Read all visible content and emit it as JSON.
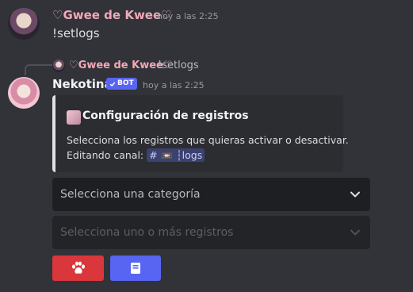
{
  "message1": {
    "author": "♡Gwee de Kwee♡",
    "timestamp": "hoy a las 2:25",
    "content": "!setlogs"
  },
  "reply": {
    "author": "♡Gwee de Kwee♡",
    "content": "!setlogs"
  },
  "message2": {
    "author": "Nekotina",
    "badge": "BOT",
    "timestamp": "hoy a las 2:25"
  },
  "embed": {
    "title": "Configuración de registros",
    "description": "Selecciona los registros que quieras activar o desactivar.",
    "channel_prefix": "Editando canal:",
    "channel_mention": "# 📼 ┆logs"
  },
  "selects": {
    "category_placeholder": "Selecciona una categoría",
    "logs_placeholder": "Selecciona uno o más registros"
  },
  "buttons": {
    "red_icon": "paw-icon",
    "blue_icon": "book-icon"
  },
  "colors": {
    "background": "#313338",
    "username_pink": "#f2a7b7",
    "bot_badge": "#5865f2",
    "danger_button": "#da373c",
    "primary_button": "#5865f2"
  }
}
